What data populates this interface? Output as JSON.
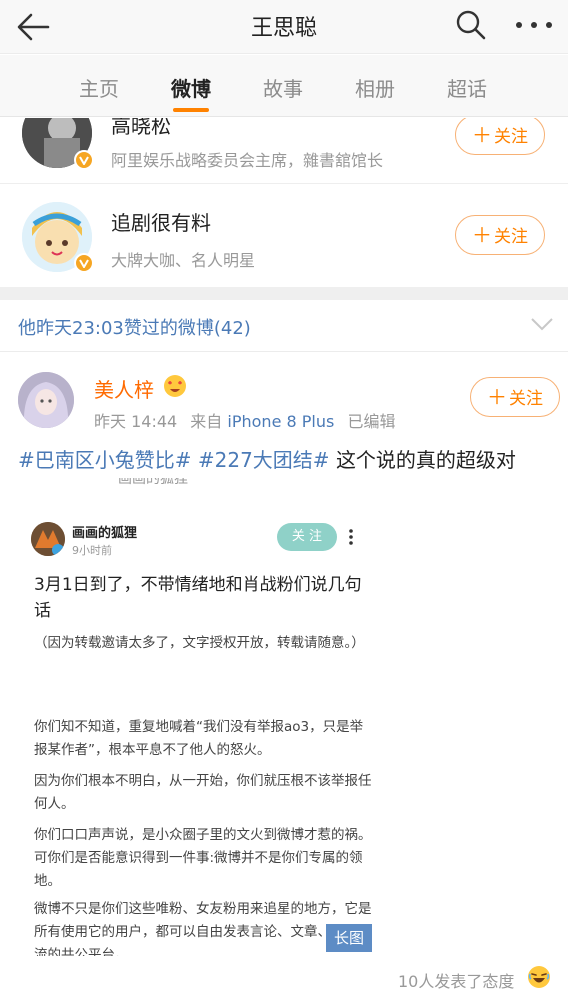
{
  "header": {
    "title": "王思聪"
  },
  "tabs": [
    {
      "label": "主页",
      "active": false
    },
    {
      "label": "微博",
      "active": true
    },
    {
      "label": "故事",
      "active": false
    },
    {
      "label": "相册",
      "active": false
    },
    {
      "label": "超话",
      "active": false
    }
  ],
  "recommended_users": [
    {
      "name": "高晓松",
      "desc": "阿里娱乐战略委员会主席，雜書舘馆长",
      "follow_label": "关注",
      "follow_plus": "＋"
    },
    {
      "name": "追剧很有料",
      "desc": "大牌大咖、名人明星",
      "follow_label": "关注",
      "follow_plus": "＋"
    }
  ],
  "liked_section": {
    "label": "他昨天23:03赞过的微博(42)"
  },
  "post": {
    "author": "美人梓",
    "time": "昨天 14:44",
    "source_prefix": "来自",
    "device": "iPhone 8 Plus",
    "edited": "已编辑",
    "follow_label": "关注",
    "follow_plus": "＋",
    "tag1": "#巴南区小兔赞比#",
    "tag2": "#227大团结#",
    "text": "这个说的真的超级对"
  },
  "embedded_image": {
    "top_name": "画画的狐狸",
    "author": "画画的狐狸",
    "time": "9小时前",
    "follow_label": "关 注",
    "headline": "3月1日到了，不带情绪地和肖战粉们说几句话",
    "paragraphs": [
      "（因为转载邀请太多了，文字授权开放，转载请随意。）",
      "你们知不知道，重复地喊着“我们没有举报ao3，只是举报某作者”，根本平息不了他人的怒火。",
      "因为你们根本不明白，从一开始，你们就压根不该举报任何人。",
      "你们口口声声说，是小众圈子里的文火到微博才惹的祸。可你们是否能意识得到一件事:微博并不是你们专属的领地。",
      "微博不只是你们这些唯粉、女友粉用来追星的地方，它是所有使用它的用户，都可以自由发表言论、文章、互相交流的共公平台。"
    ],
    "long_badge": "长图"
  },
  "reactions": {
    "label": "10人发表了态度"
  },
  "colors": {
    "accent": "#ff8200",
    "link": "#4b7ab6",
    "name_orange": "#ff6a00"
  },
  "icons": [
    "back-arrow-icon",
    "search-icon",
    "more-icon",
    "verified-badge-icon",
    "chevron-down-icon",
    "heart-eyes-emoji-icon",
    "laughing-emoji-icon",
    "more-vertical-icon"
  ]
}
